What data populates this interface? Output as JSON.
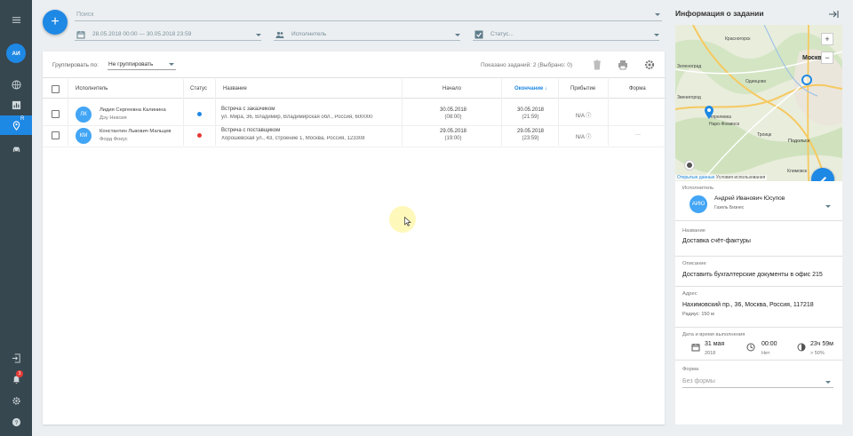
{
  "rail": {
    "user_initials": "АИ",
    "notification_count": "3",
    "active_item_suffix": "R"
  },
  "filters": {
    "search_placeholder": "Поиск",
    "date_range": "28.05.2018 00:00 — 30.05.2018 23:59",
    "performer_placeholder": "Исполнитель",
    "status_placeholder": "Статус..."
  },
  "toolbar": {
    "group_label": "Группировать по:",
    "group_value": "Не группировать",
    "shown_text": "Показано заданий: 2 (Выбрано: 0)"
  },
  "table": {
    "headers": {
      "performer": "Исполнитель",
      "status": "Статус",
      "title": "Название",
      "start": "Начало",
      "end": "Окончание ↓",
      "arrival": "Прибытие",
      "form": "Форма"
    },
    "rows": [
      {
        "initials": "ЛК",
        "name": "Лидия Сергеевна Калинина",
        "vehicle": "Дэу Нексия",
        "status_color": "#1e88e5",
        "title": "Встреча с заказчиком",
        "address": "ул. Мира, 36, Владимир, Владимирская обл., Россия, 600000",
        "start_date": "30.05.2018",
        "start_time": "(08:00)",
        "end_date": "30.05.2018",
        "end_time": "(21:59)",
        "arrival": "N/A ⓘ",
        "form": ""
      },
      {
        "initials": "КМ",
        "name": "Константин Львович Мальцев",
        "vehicle": "Форд Фокус",
        "status_color": "#e53935",
        "title": "Встреча с поставщиком",
        "address": "Хорошевская ул., 43, строение 1, Москва, Россия, 123308",
        "start_date": "29.05.2018",
        "start_time": "(19:00)",
        "end_date": "29.05.2018",
        "end_time": "(23:59)",
        "arrival": "N/A ⓘ",
        "form": "—"
      }
    ]
  },
  "panel": {
    "title": "Информация о задании",
    "map": {
      "places": [
        "Красногорск",
        "Москв",
        "Зеленоград",
        "Одинцово",
        "Звенигород",
        "Апрелевка",
        "Наро-Фоминск",
        "Троицк",
        "Подольск",
        "Климовск"
      ],
      "credit_link": "Открытые данные",
      "credit_terms": "Условия использования"
    },
    "performer_label": "Исполнитель",
    "performer_initials": "АИЮ",
    "performer_name": "Андрей Иванович Юсупов",
    "performer_vehicle": "Газель Бизнес",
    "name_label": "Название",
    "name_value": "Доставка счёт-фактуры",
    "desc_label": "Описание",
    "desc_value": "Доставить бухгалтерские документы в офис 215",
    "addr_label": "Адрес",
    "addr_value": "Нахимовский пр., 36, Москва, Россия, 117218",
    "radius": "Радиус: 150 м",
    "datetime_label": "Дата и время выполнения",
    "date_value": "31 мая",
    "date_year": "2018",
    "time_value": "00:00",
    "time_note": "Нет",
    "duration_value": "23ч 59м",
    "duration_note": "> 50%",
    "form_label": "Форма",
    "form_value": "Без формы"
  }
}
